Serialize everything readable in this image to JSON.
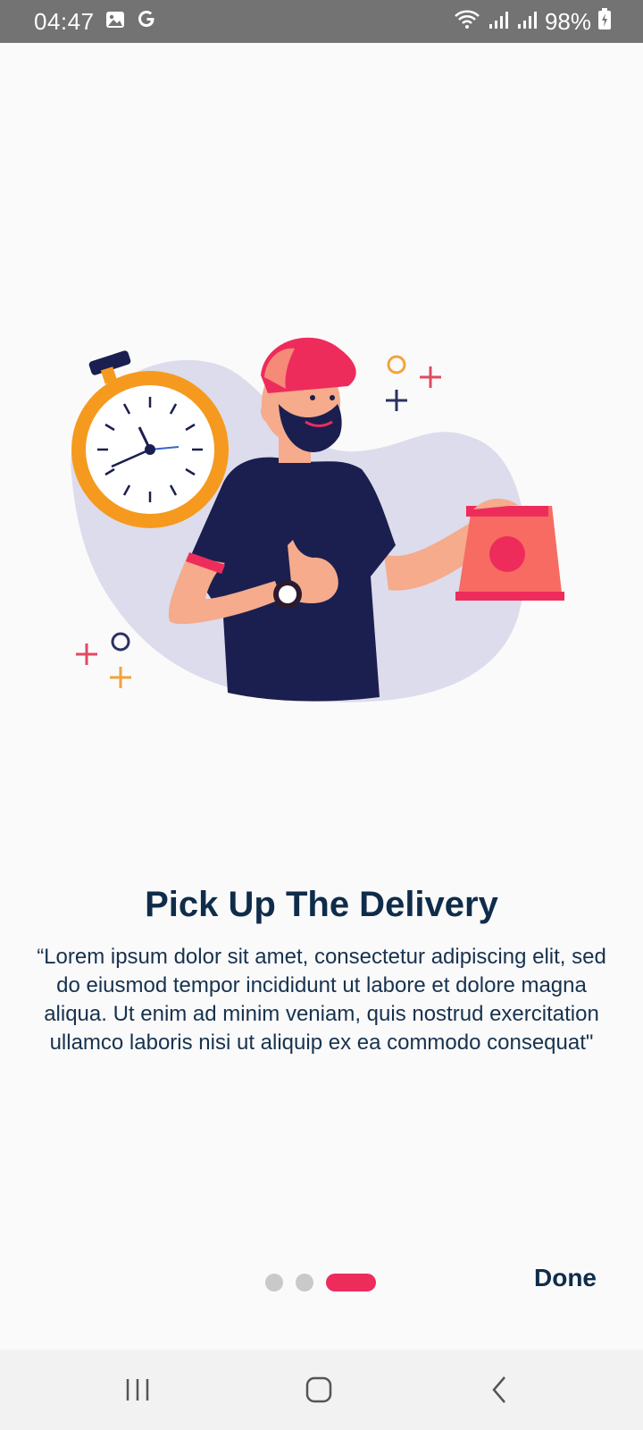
{
  "status_bar": {
    "time": "04:47",
    "battery": "98%",
    "icons": [
      "image-icon",
      "google-icon",
      "wifi-icon",
      "signal-icon",
      "signal-icon",
      "battery-charging-icon"
    ]
  },
  "onboarding": {
    "title": "Pick Up The Delivery",
    "description": "“Lorem ipsum dolor sit amet, consectetur adipiscing elit, sed do eiusmod tempor incididunt ut labore et dolore magna aliqua. Ut enim ad minim veniam, quis nostrud exercitation ullamco laboris nisi ut aliquip ex ea commodo consequat\"",
    "illustration": "delivery-man-with-stopwatch-and-package",
    "page_indicator": {
      "total": 3,
      "current": 3
    },
    "done_label": "Done"
  },
  "nav_bar": {
    "buttons": [
      "recent-apps-icon",
      "home-icon",
      "back-icon"
    ]
  },
  "colors": {
    "accent": "#ee2c5c",
    "title": "#0f2c4a",
    "text": "#17324f",
    "inactive_dot": "#c9c9c9",
    "status_bar": "#737373",
    "background": "#fafafa"
  }
}
